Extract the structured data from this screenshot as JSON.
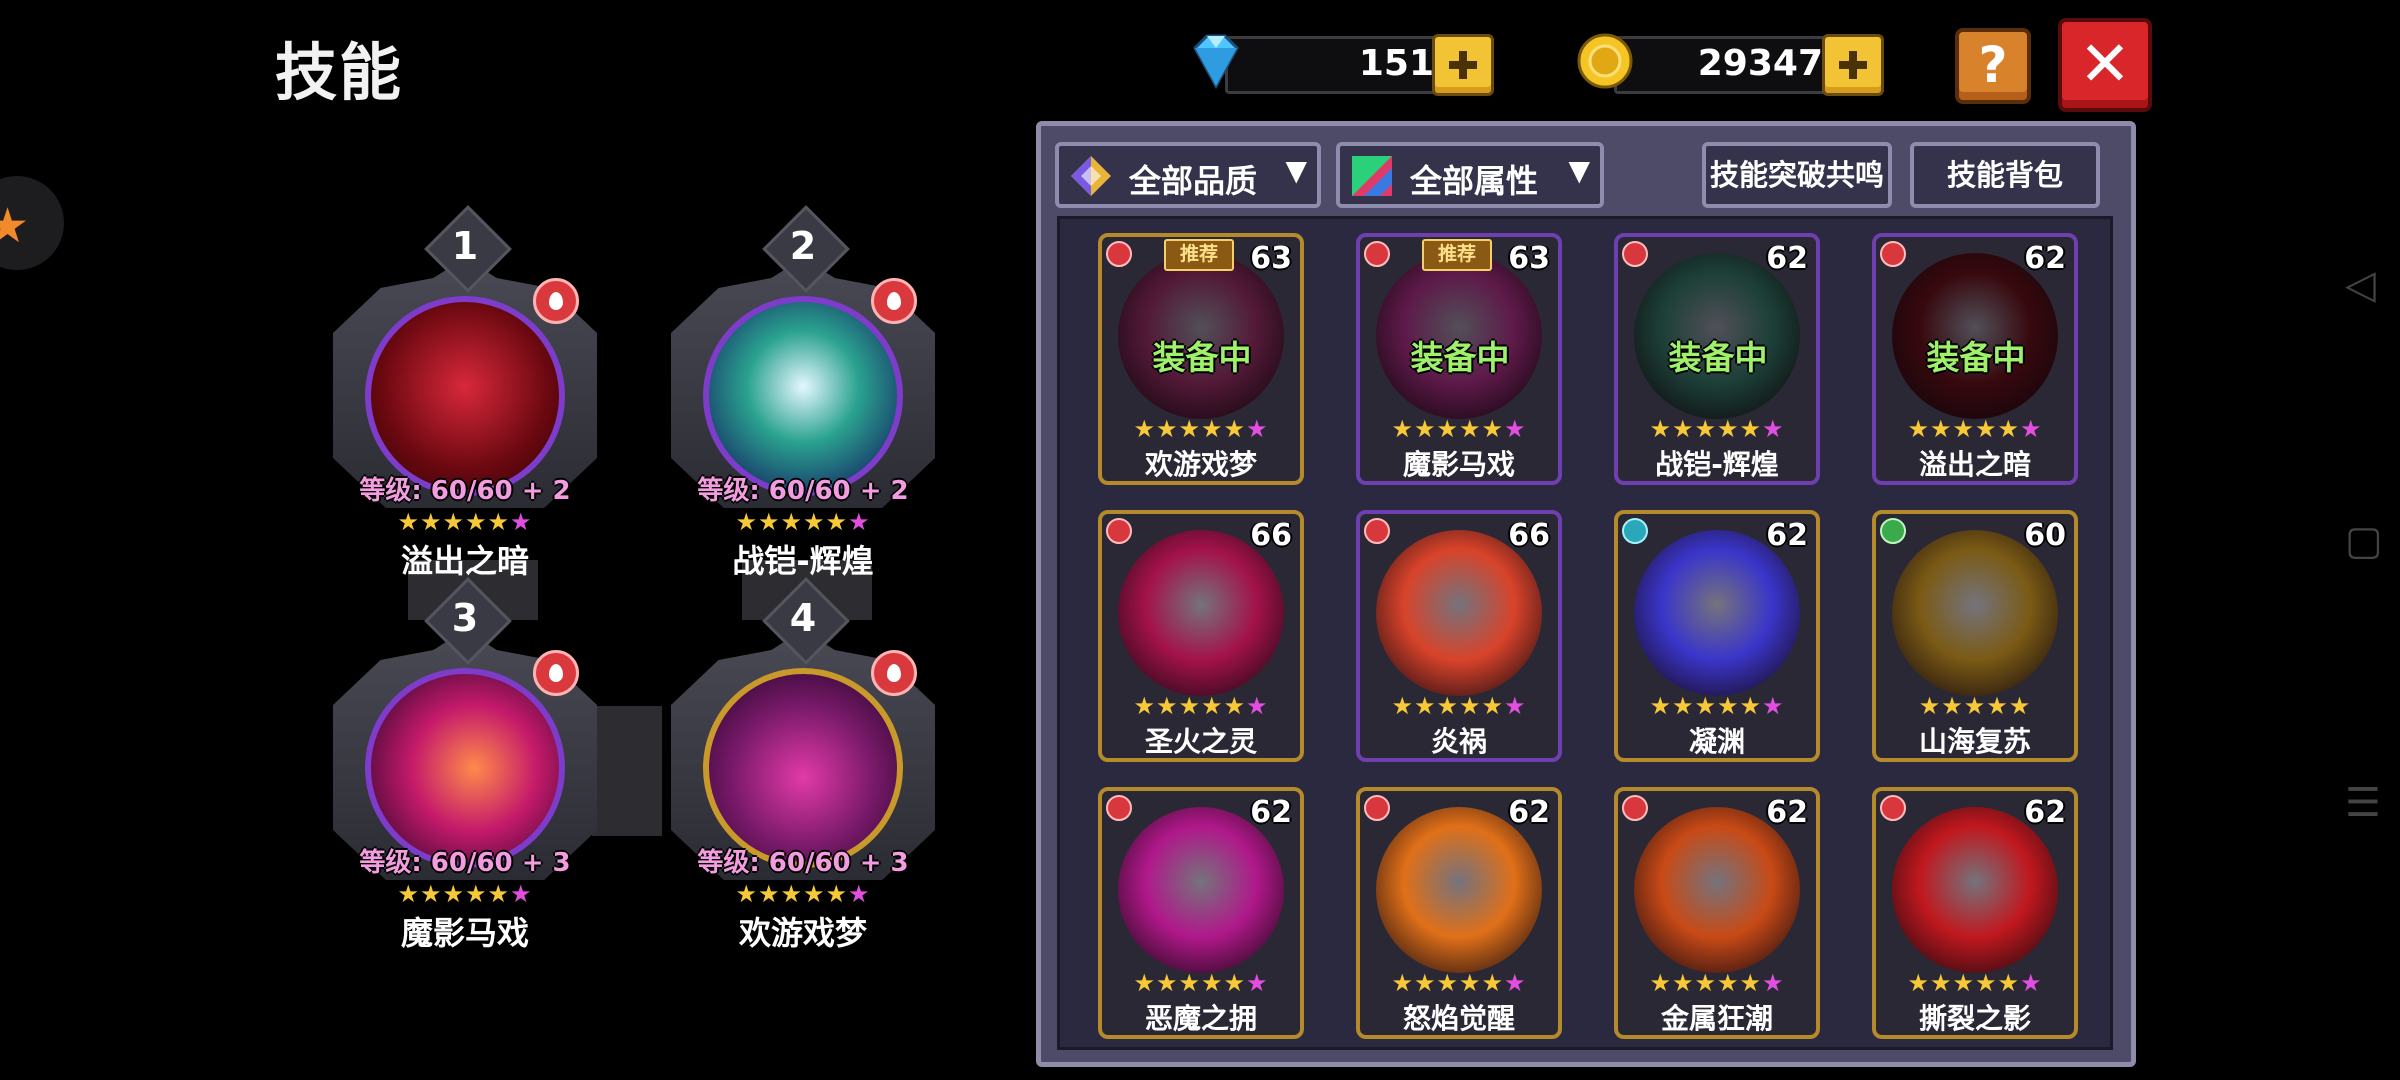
{
  "header": {
    "title": "技能"
  },
  "currency": {
    "diamonds": "151",
    "gold": "29347",
    "diamond_color": "#4fc6ff",
    "gold_color": "#f5c526"
  },
  "buttons": {
    "help": "?",
    "close": "✕"
  },
  "equipped": [
    {
      "slot": "1",
      "level": "等级: 60/60 + 2",
      "stars": "★★★★★",
      "extra_star": "★",
      "name": "溢出之暗",
      "orb": "dark-red"
    },
    {
      "slot": "2",
      "level": "等级: 60/60 + 2",
      "stars": "★★★★★",
      "extra_star": "★",
      "name": "战铠-辉煌",
      "orb": "teal-green"
    },
    {
      "slot": "3",
      "level": "等级: 60/60 + 3",
      "stars": "★★★★★",
      "extra_star": "★",
      "name": "魔影马戏",
      "orb": "magenta"
    },
    {
      "slot": "4",
      "level": "等级: 60/60 + 3",
      "stars": "★★★★★",
      "extra_star": "★",
      "name": "欢游戏梦",
      "orb": "gold-violet"
    }
  ],
  "filters": {
    "quality": "全部品质",
    "attribute": "全部属性",
    "resonance": "技能突破共鸣",
    "bag": "技能背包"
  },
  "cards": [
    {
      "name": "欢游戏梦",
      "level": "63",
      "recommend": "推荐",
      "status": "装备中",
      "element": "fire",
      "stars": "★★★★★",
      "extra_star": "★",
      "frame": "gold",
      "orb_color": "#8a2a5c"
    },
    {
      "name": "魔影马戏",
      "level": "63",
      "recommend": "推荐",
      "status": "装备中",
      "element": "fire",
      "stars": "★★★★★",
      "extra_star": "★",
      "frame": "purple",
      "orb_color": "#9c2a7a"
    },
    {
      "name": "战铠-辉煌",
      "level": "62",
      "recommend": "",
      "status": "装备中",
      "element": "fire",
      "stars": "★★★★★",
      "extra_star": "★",
      "frame": "purple",
      "orb_color": "#2f6a5c"
    },
    {
      "name": "溢出之暗",
      "level": "62",
      "recommend": "",
      "status": "装备中",
      "element": "fire",
      "stars": "★★★★★",
      "extra_star": "★",
      "frame": "purple",
      "orb_color": "#5c0f18"
    },
    {
      "name": "圣火之灵",
      "level": "66",
      "recommend": "",
      "status": "",
      "element": "fire",
      "stars": "★★★★★",
      "extra_star": "★",
      "frame": "gold",
      "orb_color": "#a3124a"
    },
    {
      "name": "炎祸",
      "level": "66",
      "recommend": "",
      "status": "",
      "element": "fire",
      "stars": "★★★★★",
      "extra_star": "★",
      "frame": "purple",
      "orb_color": "#d8432a"
    },
    {
      "name": "凝渊",
      "level": "62",
      "recommend": "",
      "status": "",
      "element": "water",
      "stars": "★★★★★",
      "extra_star": "★",
      "frame": "gold",
      "orb_color": "#3a35c9"
    },
    {
      "name": "山海复苏",
      "level": "60",
      "recommend": "",
      "status": "",
      "element": "wind",
      "stars": "★★★★★",
      "extra_star": "",
      "frame": "gold",
      "orb_color": "#7a5a14"
    },
    {
      "name": "恶魔之拥",
      "level": "62",
      "recommend": "",
      "status": "",
      "element": "fire",
      "stars": "★★★★★",
      "extra_star": "★",
      "frame": "gold",
      "orb_color": "#b0188a"
    },
    {
      "name": "怒焰觉醒",
      "level": "62",
      "recommend": "",
      "status": "",
      "element": "fire",
      "stars": "★★★★★",
      "extra_star": "★",
      "frame": "gold",
      "orb_color": "#e07018"
    },
    {
      "name": "金属狂潮",
      "level": "62",
      "recommend": "",
      "status": "",
      "element": "fire",
      "stars": "★★★★★",
      "extra_star": "★",
      "frame": "gold",
      "orb_color": "#c84a16"
    },
    {
      "name": "撕裂之影",
      "level": "62",
      "recommend": "",
      "status": "",
      "element": "fire",
      "stars": "★★★★★",
      "extra_star": "★",
      "frame": "gold",
      "orb_color": "#c0181e"
    }
  ],
  "system_nav": {
    "back": "◁",
    "home": "▢",
    "menu": "☰"
  }
}
